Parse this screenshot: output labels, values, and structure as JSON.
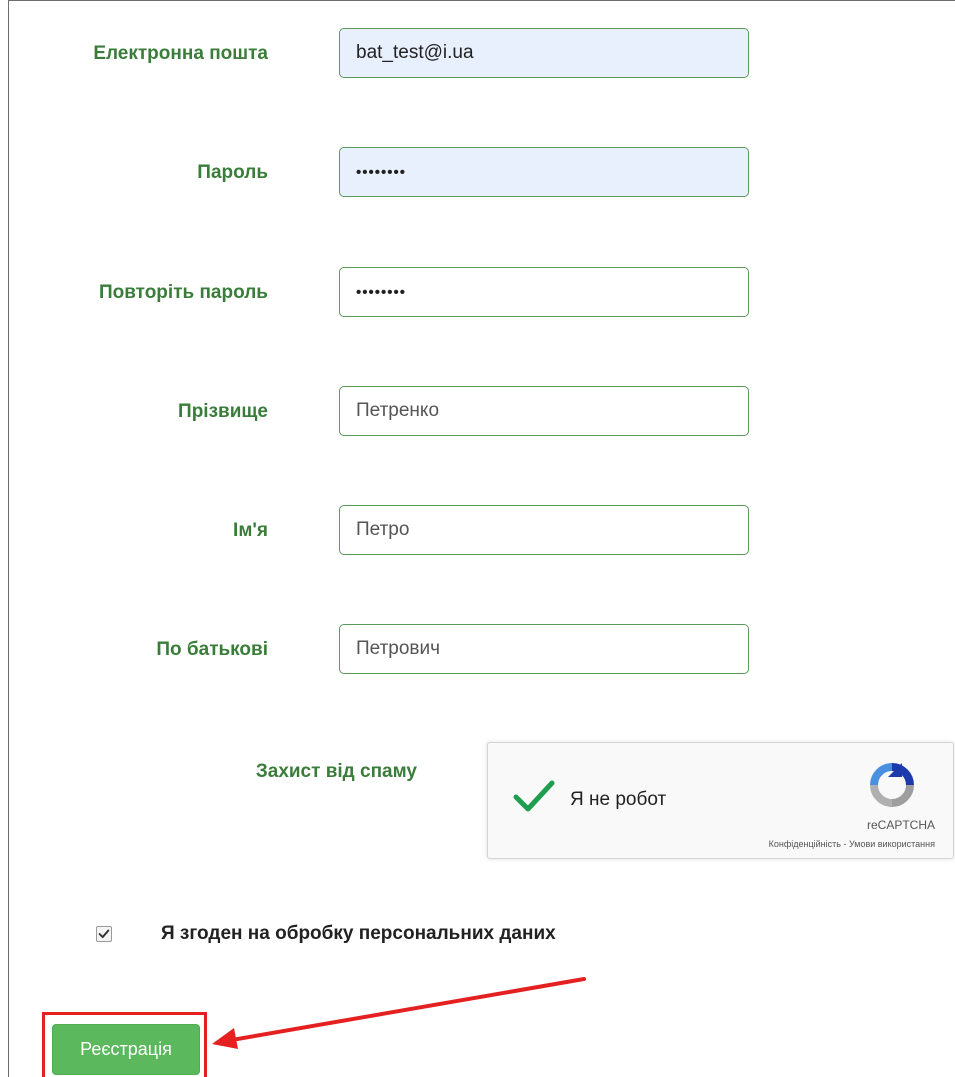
{
  "form": {
    "fields": [
      {
        "label": "Електронна пошта",
        "value": "bat_test@i.ua"
      },
      {
        "label": "Пароль",
        "value": "••••••••"
      },
      {
        "label": "Повторіть пароль",
        "value": "••••••••"
      },
      {
        "label": "Прізвище",
        "value": "Петренко"
      },
      {
        "label": "Ім'я",
        "value": "Петро"
      },
      {
        "label": "По батькові",
        "value": "Петрович"
      }
    ],
    "spam_label": "Захист від спаму",
    "recaptcha": {
      "text": "Я не робот",
      "brand": "reCAPTCHA",
      "privacy": "Конфіденційність",
      "separator": " - ",
      "terms": "Умови використання",
      "checked": true
    },
    "agree": {
      "label": "Я згоден на обробку персональних даних",
      "checked": true
    },
    "submit_label": "Реєстрація"
  },
  "colors": {
    "label": "#3a7d3a",
    "input_border": "#5a9a5a",
    "autofill_bg": "#e8f0fe",
    "button": "#5cb85c",
    "annotation": "#e52020",
    "recaptcha_check": "#1e9e4e"
  }
}
